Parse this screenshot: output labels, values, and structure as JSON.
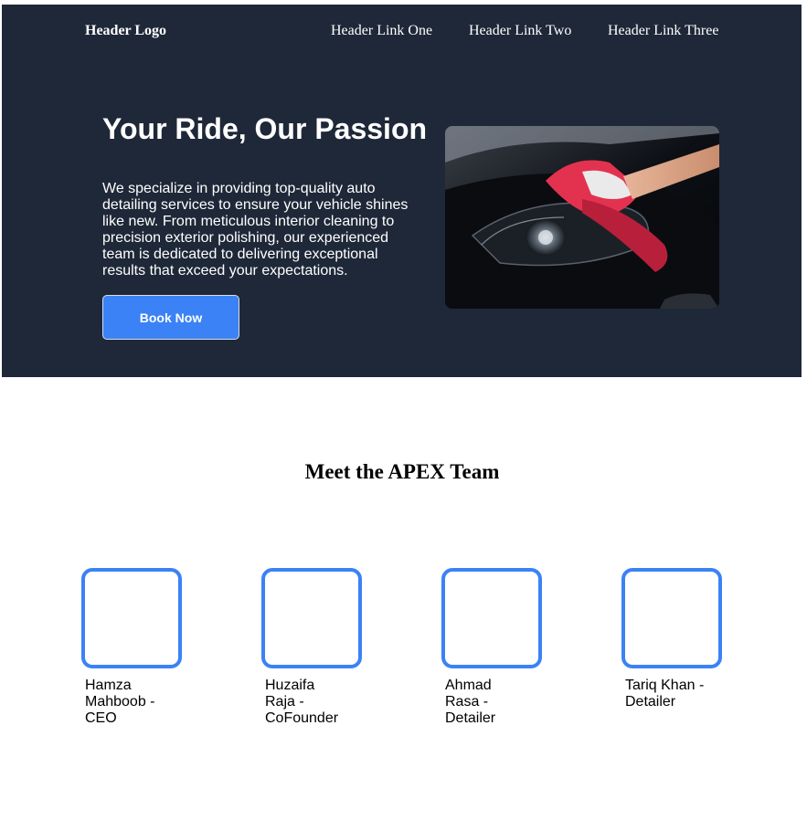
{
  "header": {
    "logo": "Header Logo",
    "links": [
      "Header Link One",
      "Header Link Two",
      "Header Link Three"
    ]
  },
  "hero": {
    "title": "Your Ride, Our Passion",
    "text": "We specialize in providing top-quality auto detailing services to ensure your vehicle shines like new. From meticulous interior cleaning to precision exterior polishing, our experienced team is dedicated to delivering exceptional results that exceed your expectations.",
    "button_label": "Book Now",
    "image_subject": "hand-polishing-car-headlight-image"
  },
  "team": {
    "title": "Meet the APEX Team",
    "members": [
      {
        "name": "Hamza Mahboob - CEO"
      },
      {
        "name": "Huzaifa Raja - CoFounder"
      },
      {
        "name": "Ahmad Rasa - Detailer"
      },
      {
        "name": "Tariq Khan - Detailer"
      }
    ]
  },
  "colors": {
    "hero_background": "#1f2838",
    "accent": "#3b82f6",
    "text_light": "#ffffff",
    "text_dark": "#000000"
  }
}
